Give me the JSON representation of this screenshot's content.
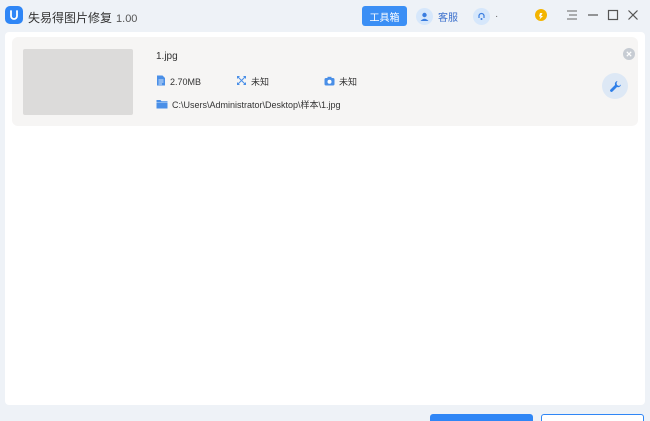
{
  "app": {
    "title": "失易得图片修复",
    "version": "1.00",
    "accent_color": "#2f86f6"
  },
  "header": {
    "toolbox_label": "工具箱",
    "service_label": "客服",
    "account_label": "·"
  },
  "file": {
    "name": "1.jpg",
    "size": "2.70MB",
    "resolution": "未知",
    "camera": "未知",
    "path": "C:\\Users\\Administrator\\Desktop\\样本\\1.jpg"
  },
  "icons": {
    "logo": "app-logo-icon",
    "service": "headset-user-icon",
    "account": "user-avatar-icon",
    "coin": "coin-icon",
    "menu": "menu-icon",
    "minimize": "minimize-icon",
    "maximize": "maximize-icon",
    "close": "close-icon",
    "size": "document-icon",
    "resolution": "resize-icon",
    "camera": "camera-icon",
    "folder": "folder-icon",
    "remove": "remove-icon",
    "repair": "wrench-icon"
  }
}
